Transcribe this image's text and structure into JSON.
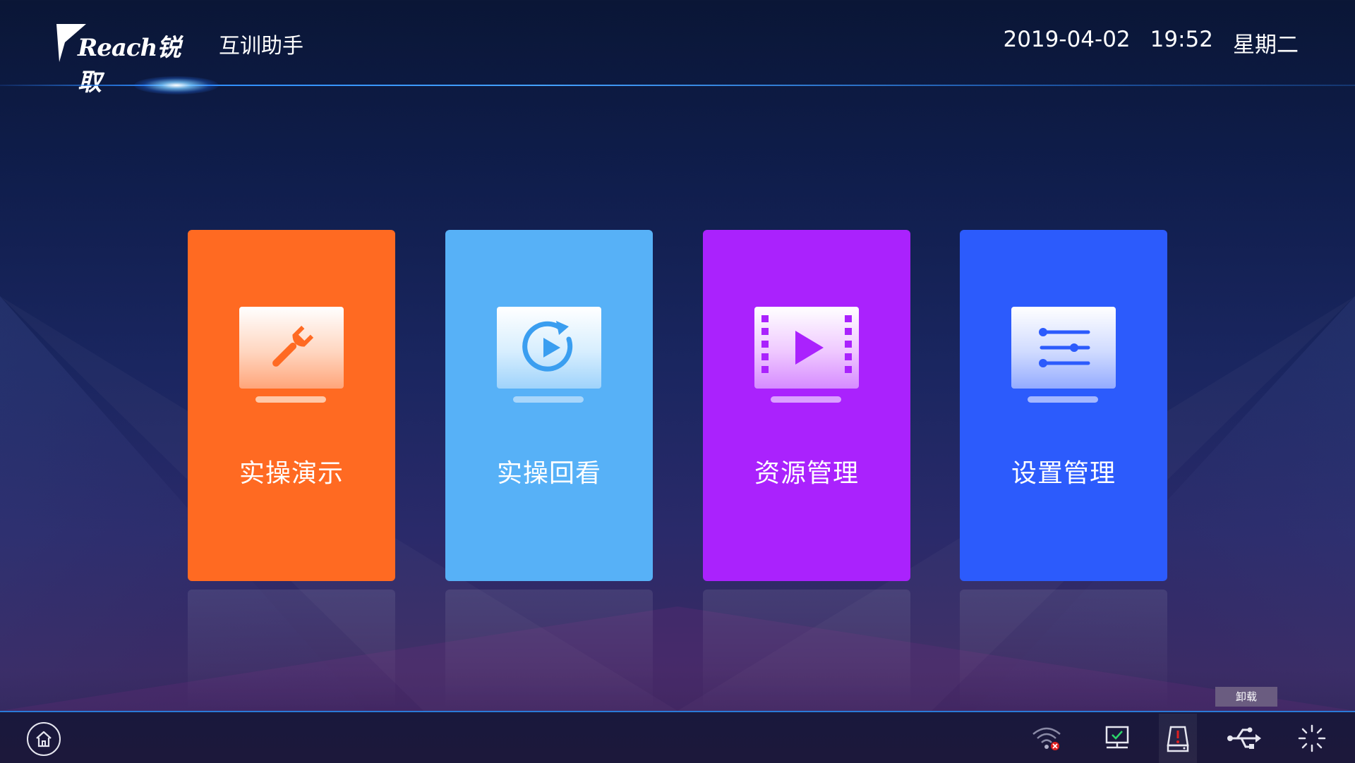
{
  "header": {
    "logo_text": "Reach锐取",
    "app_title": "互训助手",
    "date": "2019-04-02",
    "time": "19:52",
    "weekday": "星期二"
  },
  "tiles": [
    {
      "label": "实操演示",
      "icon": "wrench-icon",
      "color": "#ff6a22"
    },
    {
      "label": "实操回看",
      "icon": "replay-icon",
      "color": "#57b1f7"
    },
    {
      "label": "资源管理",
      "icon": "video-film-icon",
      "color": "#aa22fd"
    },
    {
      "label": "设置管理",
      "icon": "sliders-icon",
      "color": "#2c5bfc"
    }
  ],
  "bottom_bar": {
    "home_icon": "home-icon",
    "status_icons": [
      "wifi-disconnected-icon",
      "screen-connected-icon",
      "storage-warning-icon",
      "usb-icon",
      "loading-spinner-icon"
    ],
    "tooltip": "卸载"
  },
  "colors": {
    "accent_line": "#2d8cff",
    "warning": "#e02020",
    "ok": "#2bd46a"
  }
}
